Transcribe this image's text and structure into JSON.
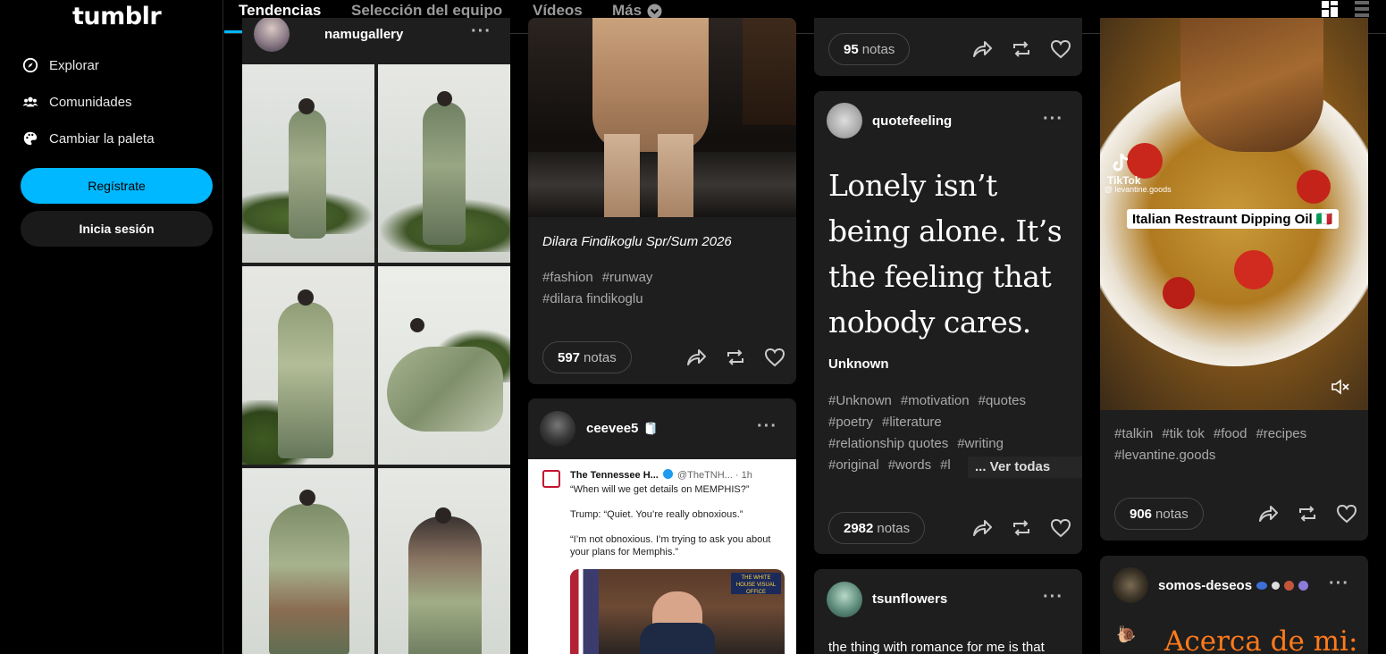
{
  "logo": "tumblr",
  "sidebar": {
    "items": [
      {
        "label": "Explorar",
        "icon": "compass-icon"
      },
      {
        "label": "Comunidades",
        "icon": "people-icon"
      },
      {
        "label": "Cambiar la paleta",
        "icon": "palette-icon"
      }
    ],
    "register_label": "Regístrate",
    "login_label": "Inicia sesión"
  },
  "topbar": {
    "tabs": [
      "Tendencias",
      "Selección del equipo",
      "Vídeos",
      "Más"
    ],
    "active_tab": "Tendencias"
  },
  "colors": {
    "accent": "#00b8ff",
    "card": "#1e1e1e",
    "quote_orange": "#ff7a1a"
  },
  "posts": {
    "namugallery": {
      "blog": "namugallery"
    },
    "fashion": {
      "caption": "Dilara Findikoglu Spr/Sum 2026",
      "tags": [
        "#fashion",
        "#runway",
        "#dilara findikoglu"
      ],
      "notes_count": "597",
      "notes_label": "notas"
    },
    "ceevee": {
      "blog": "ceevee5",
      "tweet_author": "The Tennessee H...",
      "tweet_handle": "@TheTNH...",
      "tweet_time": "· 1h",
      "tweet_line1": "“When will we get details on MEMPHIS?”",
      "tweet_line2": "Trump: “Quiet. You’re really obnoxious.”",
      "tweet_line3": "“I’m not obnoxious. I’m trying to ask you about your plans for Memphis.”",
      "tweet_badge": "THE WHITE HOUSE VISUAL OFFICE"
    },
    "top3": {
      "notes_count": "95",
      "notes_label": "notas"
    },
    "quote": {
      "blog": "quotefeeling",
      "text": "Lonely isn’t being alone. It’s the feeling that nobody cares.",
      "source": "Unknown",
      "tags": [
        "#Unknown",
        "#motivation",
        "#quotes",
        "#poetry",
        "#literature",
        "#relationship quotes",
        "#writing",
        "#original",
        "#words",
        "#l"
      ],
      "see_all": "... Ver todas",
      "notes_count": "2982",
      "notes_label": "notas"
    },
    "tsunflowers": {
      "blog": "tsunflowers",
      "text": "the thing with romance for me is that"
    },
    "food": {
      "tiktok_label": "TikTok",
      "tiktok_handle": "@ levantine.goods",
      "overlay": "Italian Restraunt Dipping Oil 🇮🇹",
      "tags": [
        "#talkin",
        "#tik tok",
        "#food",
        "#recipes",
        "#levantine.goods"
      ],
      "notes_count": "906",
      "notes_label": "notas"
    },
    "somos": {
      "blog": "somos-deseos",
      "heading": "Acerca de mi:"
    }
  }
}
